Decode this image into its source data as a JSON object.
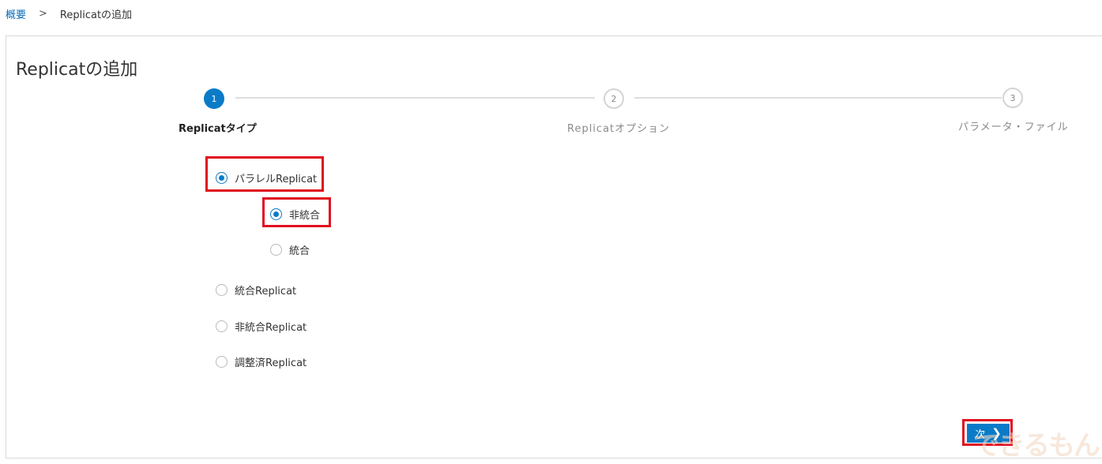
{
  "breadcrumb": {
    "root": "概要",
    "separator": ">",
    "current": "Replicatの追加"
  },
  "page": {
    "title": "Replicatの追加"
  },
  "stepper": {
    "steps": [
      {
        "number": "1",
        "label": "Replicatタイプ",
        "state": "active"
      },
      {
        "number": "2",
        "label": "Replicatオプション",
        "state": "inactive"
      },
      {
        "number": "3",
        "label": "パラメータ・ファイル",
        "state": "inactive"
      }
    ]
  },
  "options": {
    "parallel": {
      "label": "パラレルReplicat",
      "checked": true
    },
    "non_integrated": {
      "label": "非統合",
      "checked": true
    },
    "integrated": {
      "label": "統合",
      "checked": false
    },
    "integrated_replicat": {
      "label": "統合Replicat",
      "checked": false
    },
    "non_integrated_replicat": {
      "label": "非統合Replicat",
      "checked": false
    },
    "coordinated_replicat": {
      "label": "調整済Replicat",
      "checked": false
    }
  },
  "actions": {
    "next_label": "次",
    "next_icon": "chevron-right-icon"
  },
  "watermark": "できるもん",
  "colors": {
    "accent": "#0b7bc8",
    "highlight": "#e01020"
  }
}
